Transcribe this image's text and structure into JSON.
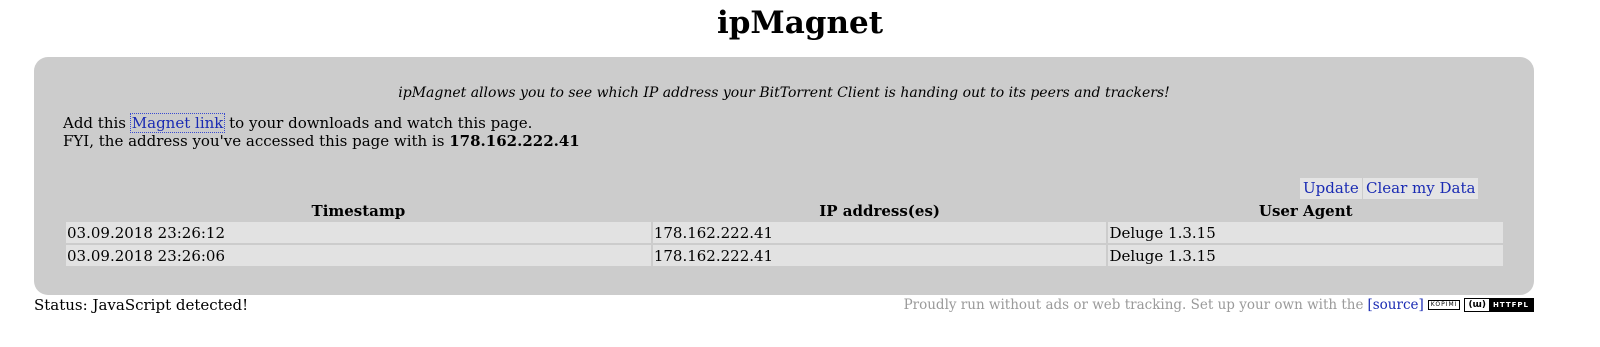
{
  "header": {
    "title": "ipMagnet"
  },
  "intro": {
    "tagline": "ipMagnet allows you to see which IP address your BitTorrent Client is handing out to its peers and trackers!",
    "line1_prefix": "Add this",
    "magnet_link_text": "Magnet link",
    "line1_suffix": "to your downloads and watch this page.",
    "line2_prefix": "FYI, the address you've accessed this page with is",
    "accessed_ip": "178.162.222.41"
  },
  "buttons": {
    "update": "Update",
    "clear": "Clear my Data"
  },
  "table": {
    "headers": [
      "Timestamp",
      "IP address(es)",
      "User Agent"
    ],
    "rows": [
      [
        "03.09.2018 23:26:12",
        "178.162.222.41",
        "Deluge 1.3.15"
      ],
      [
        "03.09.2018 23:26:06",
        "178.162.222.41",
        "Deluge 1.3.15"
      ]
    ]
  },
  "status": {
    "text": "Status: JavaScript detected!"
  },
  "footer": {
    "text": "Proudly run without ads or web tracking. Set up your own with the",
    "source_link": "[source]",
    "badge_left": "KOPIMI",
    "license_icon": "cc-icon",
    "license_symbol": "(ɯ)",
    "license_text": "HTTFPL"
  },
  "colors": {
    "panel": "#cccccc",
    "link": "#1a2bb3",
    "cell": "#e2e2e2",
    "footer_text": "#9a9a9a"
  }
}
